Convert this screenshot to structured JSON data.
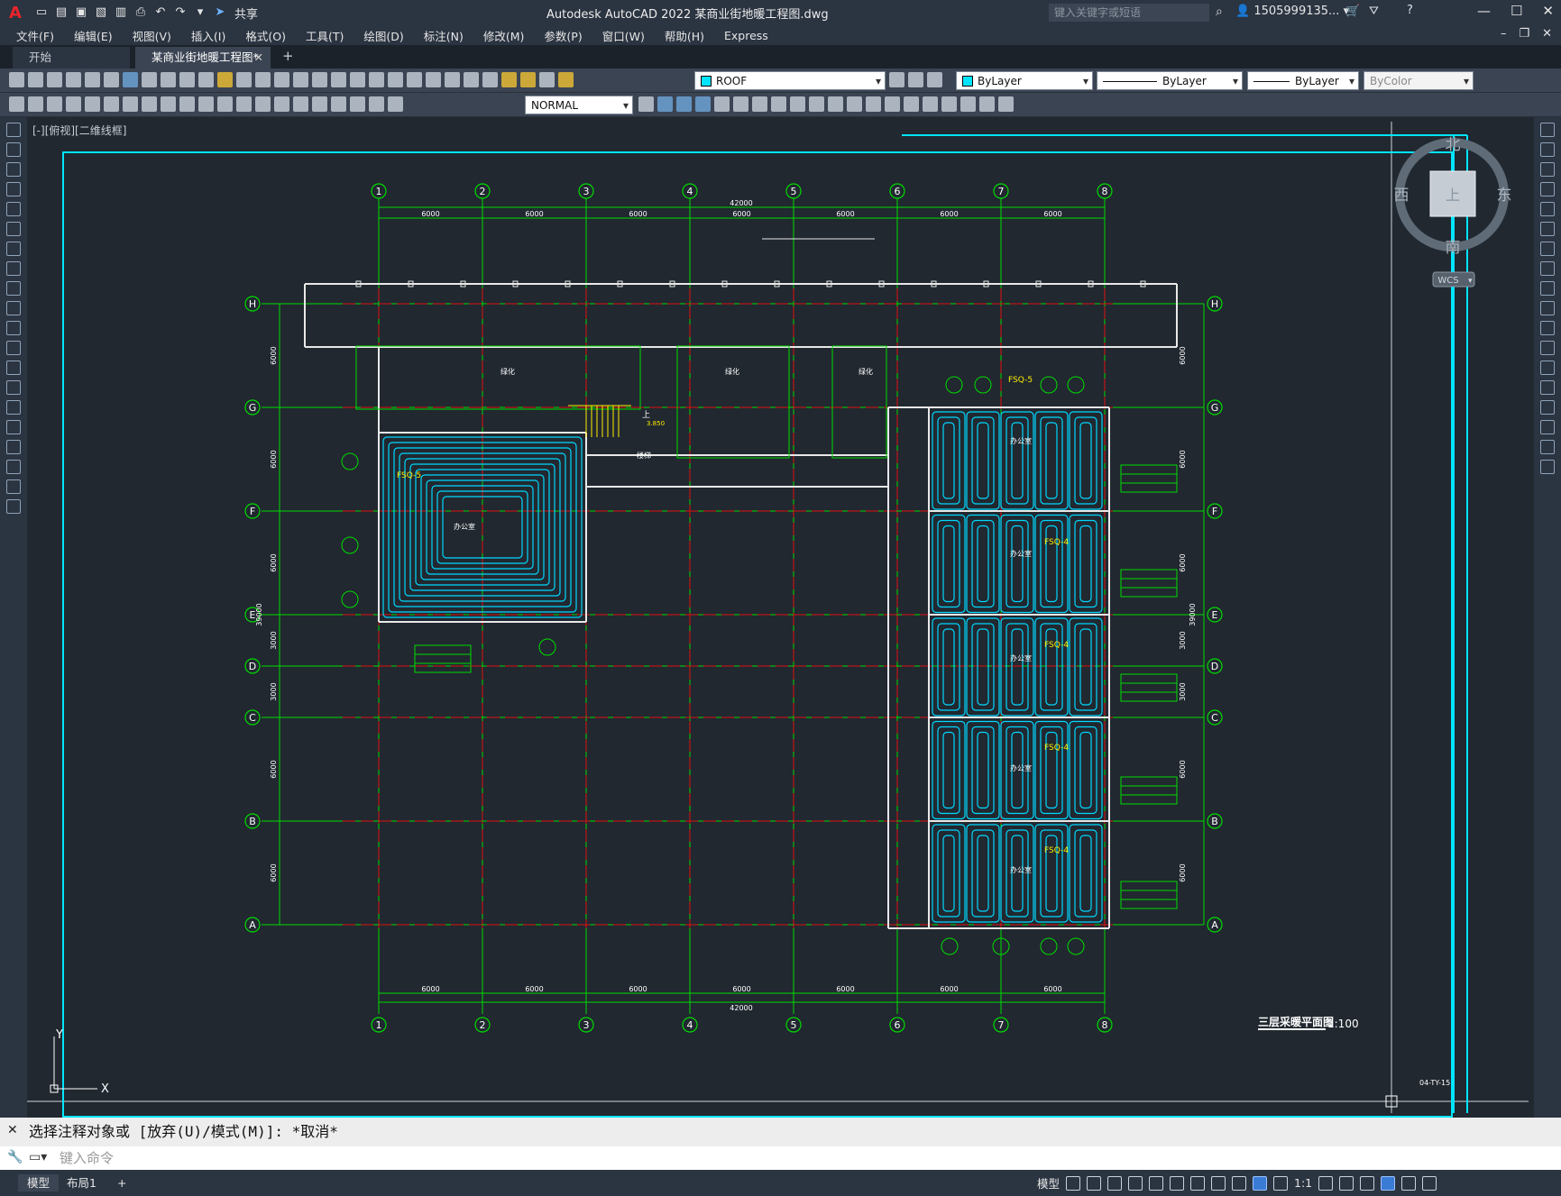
{
  "titlebar": {
    "app_title": "Autodesk AutoCAD 2022    某商业街地暖工程图.dwg",
    "share": "共享",
    "search_placeholder": "键入关键字或短语",
    "user": "1505999135...",
    "logo": "A"
  },
  "menu": [
    "文件(F)",
    "编辑(E)",
    "视图(V)",
    "插入(I)",
    "格式(O)",
    "工具(T)",
    "绘图(D)",
    "标注(N)",
    "修改(M)",
    "参数(P)",
    "窗口(W)",
    "帮助(H)",
    "Express"
  ],
  "tabs": {
    "start": "开始",
    "document": "某商业街地暖工程图*",
    "add": "+"
  },
  "toolbar": {
    "layer": "ROOF",
    "color": "ByLayer",
    "linetype": "ByLayer",
    "lineweight": "ByLayer",
    "plotstyle": "ByColor",
    "dimstyle": "NORMAL",
    "layer_color": "#00e5ff"
  },
  "viewport": {
    "label": "[-][俯视][二维线框]",
    "viewcube": {
      "north": "北",
      "south": "南",
      "east": "东",
      "west": "西",
      "top": "上",
      "wcs": "WCS"
    }
  },
  "drawing": {
    "columns": [
      "1",
      "2",
      "3",
      "4",
      "5",
      "6",
      "7",
      "8"
    ],
    "rows": [
      "H",
      "G",
      "F",
      "E",
      "D",
      "C",
      "B",
      "A"
    ],
    "top_dims": [
      "6000",
      "6000",
      "6000",
      "6000",
      "6000",
      "6000",
      "6000"
    ],
    "bottom_dims": [
      "6000",
      "6000",
      "6000",
      "6000",
      "6000",
      "6000",
      "6000"
    ],
    "total_dim": "42000",
    "left_dims": [
      "6000",
      "6000",
      "6000",
      "3000",
      "3000",
      "6000",
      "6000"
    ],
    "side_total": "39000",
    "room_labels": [
      "绿化",
      "绿化",
      "绿化",
      "办公室",
      "办公室",
      "办公室",
      "办公室",
      "办公室",
      "办公室"
    ],
    "manifold_labels": [
      "FSQ-5",
      "FSQ-5",
      "FSQ-4",
      "FSQ-4",
      "FSQ-4",
      "FSQ-4"
    ],
    "stair_label": "上",
    "stair_room": "楼梯",
    "elevation": "3.850",
    "plan_title": "三层采暖平面图",
    "plan_scale": "1:100",
    "sheet_code": "04-TY-15"
  },
  "command": {
    "history": "选择注释对象或 [放弃(U)/模式(M)]: *取消*",
    "placeholder": "键入命令"
  },
  "status": {
    "model_tab": "模型",
    "layout_tab": "布局1",
    "add": "+",
    "model_label": "模型",
    "scale": "1:1"
  }
}
